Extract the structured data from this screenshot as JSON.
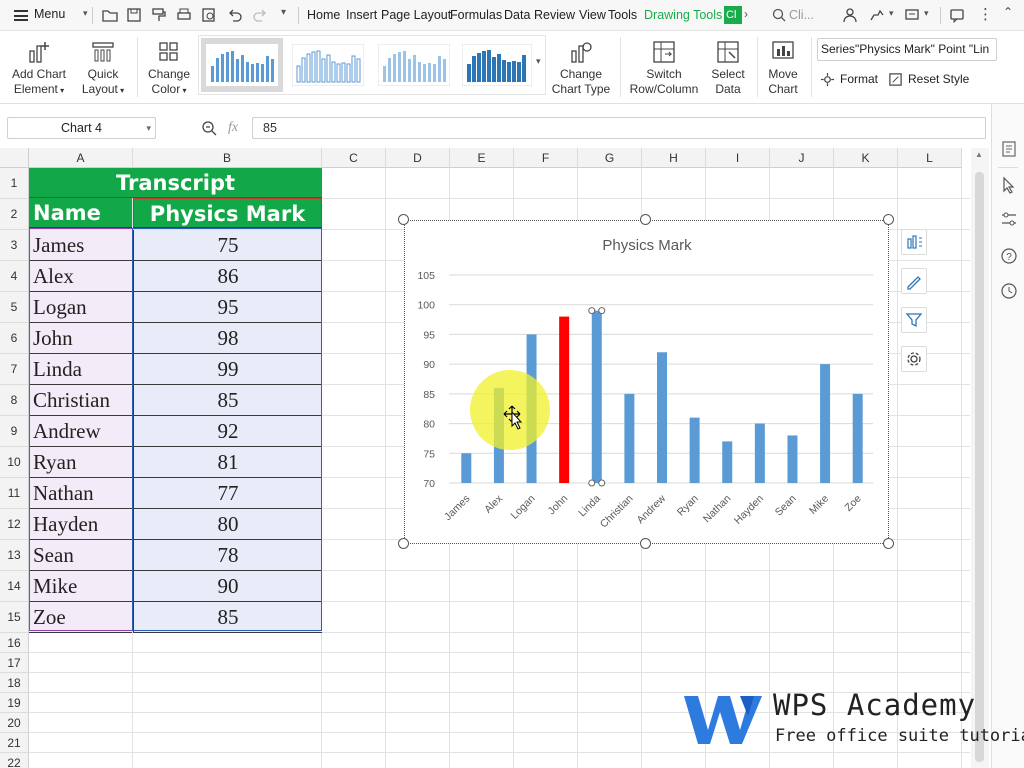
{
  "menubar": {
    "menu_label": "Menu",
    "tabs": [
      "Home",
      "Insert",
      "Page Layout",
      "Formulas",
      "Data",
      "Review",
      "View",
      "Tools"
    ],
    "drawing_tools": "Drawing Tools",
    "chart_tools_stub": "Cl",
    "search_placeholder": "Cli..."
  },
  "ribbon": {
    "add_chart_element": [
      "Add Chart",
      "Element"
    ],
    "quick_layout": [
      "Quick",
      "Layout"
    ],
    "change_color": [
      "Change",
      "Color"
    ],
    "change_chart_type": [
      "Change",
      "Chart Type"
    ],
    "switch_row_column": [
      "Switch",
      "Row/Column"
    ],
    "select_data": [
      "Select",
      "Data"
    ],
    "move_chart": [
      "Move",
      "Chart"
    ],
    "series_select": "Series\"Physics Mark\" Point \"Lin",
    "format": "Format",
    "reset_style": "Reset Style"
  },
  "formula_bar": {
    "name_box": "Chart 4",
    "fx": "fx",
    "value": "85"
  },
  "columns": [
    "A",
    "B",
    "C",
    "D",
    "E",
    "F",
    "G",
    "H",
    "I",
    "J",
    "K",
    "L"
  ],
  "rows": [
    "1",
    "2",
    "3",
    "4",
    "5",
    "6",
    "7",
    "8",
    "9",
    "10",
    "11",
    "12",
    "13",
    "14",
    "15",
    "16",
    "17",
    "18",
    "19",
    "20",
    "21",
    "22"
  ],
  "table": {
    "title": "Transcript",
    "headers": [
      "Name",
      "Physics Mark"
    ],
    "names": [
      "James",
      "Alex",
      "Logan",
      "John",
      "Linda",
      "Christian",
      "Andrew",
      "Ryan",
      "Nathan",
      "Hayden",
      "Sean",
      "Mike",
      "Zoe"
    ],
    "marks": [
      "75",
      "86",
      "95",
      "98",
      "99",
      "85",
      "92",
      "81",
      "77",
      "80",
      "78",
      "90",
      "85"
    ]
  },
  "chart_data": {
    "type": "bar",
    "title": "Physics Mark",
    "categories": [
      "James",
      "Alex",
      "Logan",
      "John",
      "Linda",
      "Christian",
      "Andrew",
      "Ryan",
      "Nathan",
      "Hayden",
      "Sean",
      "Mike",
      "Zoe"
    ],
    "values": [
      75,
      86,
      95,
      98,
      99,
      85,
      92,
      81,
      77,
      80,
      78,
      90,
      85
    ],
    "ylim": [
      70,
      105
    ],
    "yticks": [
      70,
      75,
      80,
      85,
      90,
      95,
      100,
      105
    ],
    "grid": true,
    "bar_color": "#5b9bd5",
    "highlight_color": "#ff0000",
    "highlight_index": 3
  },
  "branding": {
    "name": "WPS Academy",
    "tagline": "Free office suite tutorials"
  },
  "colors": {
    "header_green": "#12a847",
    "accent_green": "#1aab4a"
  }
}
